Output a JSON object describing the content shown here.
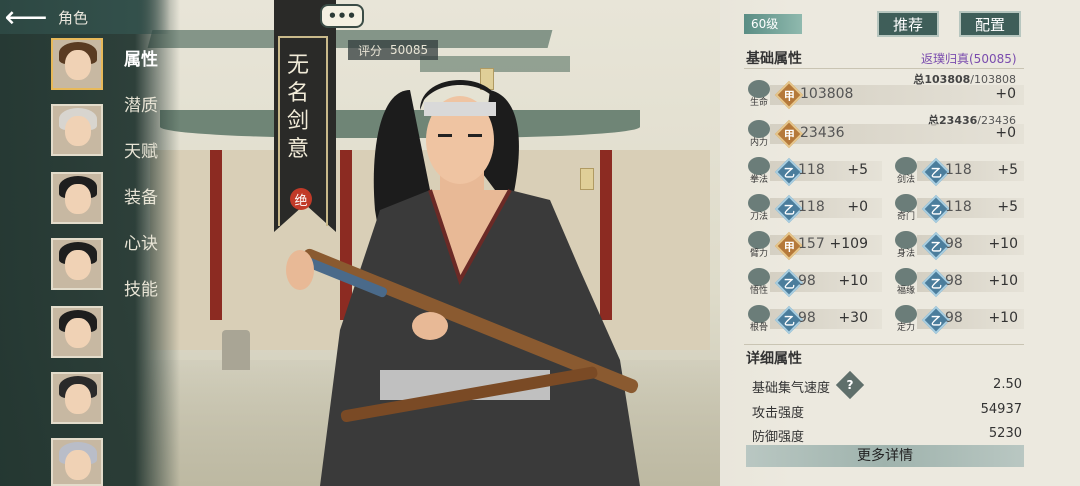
{
  "top_bar": {
    "back_icon": "back-arrow-icon",
    "title": "角色"
  },
  "sidebar": {
    "items": [
      {
        "label": "属性",
        "active": true
      },
      {
        "label": "潜质"
      },
      {
        "label": "天赋"
      },
      {
        "label": "装备"
      },
      {
        "label": "心诀"
      },
      {
        "label": "技能"
      }
    ],
    "avatars": 7
  },
  "chat_bubble": "•••",
  "banner": {
    "name": "无名剑意",
    "seal": "绝"
  },
  "score": {
    "label": "评分",
    "value": "50085"
  },
  "header": {
    "level": "60级",
    "recommend_label": "推荐",
    "config_label": "配置"
  },
  "basic": {
    "title": "基础属性",
    "fanpu": "返璞归真(50085)",
    "hp": {
      "total_prefix": "总",
      "total": "103808",
      "max": "/103808",
      "icon_label": "生命",
      "grade": "甲",
      "value": "103808",
      "bonus": "+0"
    },
    "mp": {
      "total_prefix": "总",
      "total": "23436",
      "max": "/23436",
      "icon_label": "内力",
      "grade": "甲",
      "value": "23436",
      "bonus": "+0"
    },
    "stats": [
      {
        "label": "拳法",
        "grade": "乙",
        "value": "118",
        "bonus": "+5"
      },
      {
        "label": "剑法",
        "grade": "乙",
        "value": "118",
        "bonus": "+5"
      },
      {
        "label": "刀法",
        "grade": "乙",
        "value": "118",
        "bonus": "+0"
      },
      {
        "label": "奇门",
        "grade": "乙",
        "value": "118",
        "bonus": "+5"
      },
      {
        "label": "臂力",
        "grade": "甲",
        "value": "157",
        "bonus": "+109"
      },
      {
        "label": "身法",
        "grade": "乙",
        "value": "98",
        "bonus": "+10"
      },
      {
        "label": "悟性",
        "grade": "乙",
        "value": "98",
        "bonus": "+10"
      },
      {
        "label": "福缘",
        "grade": "乙",
        "value": "98",
        "bonus": "+10"
      },
      {
        "label": "根骨",
        "grade": "乙",
        "value": "98",
        "bonus": "+30"
      },
      {
        "label": "定力",
        "grade": "乙",
        "value": "98",
        "bonus": "+10"
      }
    ]
  },
  "detail": {
    "title": "详细属性",
    "rows": [
      {
        "label": "基础集气速度",
        "value": "2.50"
      },
      {
        "label": "攻击强度",
        "value": "54937"
      },
      {
        "label": "防御强度",
        "value": "5230"
      }
    ],
    "help": "?",
    "more_label": "更多详情"
  },
  "colors": {
    "jia": "#b5793a",
    "yi": "#4b7d9c",
    "panel_btn": "#3f5e59",
    "fanpu": "#7a4cae"
  }
}
